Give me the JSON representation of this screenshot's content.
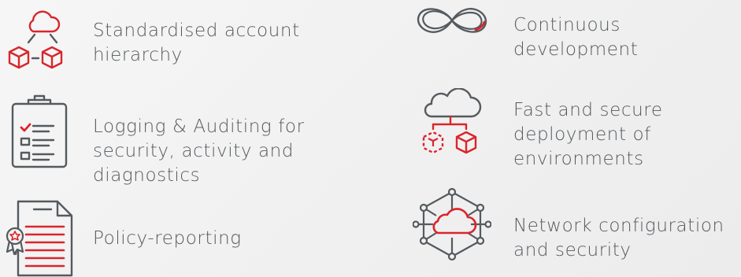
{
  "features": {
    "left": [
      {
        "label": "Standardised account\nhierarchy",
        "icon": "cloud-hierarchy-icon"
      },
      {
        "label": "Logging & Auditing for\nsecurity, activity and\ndiagnostics",
        "icon": "clipboard-checklist-icon"
      },
      {
        "label": "Policy-reporting",
        "icon": "policy-document-icon"
      }
    ],
    "right": [
      {
        "label": "Continuous\ndevelopment",
        "icon": "infinity-loop-icon"
      },
      {
        "label": "Fast and secure\ndeployment of\nenvironments",
        "icon": "cloud-deployment-icon"
      },
      {
        "label": "Network configuration\nand security",
        "icon": "cloud-network-icon"
      }
    ]
  },
  "colors": {
    "accent": "#d9262c",
    "stroke": "#555a5e",
    "text": "#555a5e"
  }
}
